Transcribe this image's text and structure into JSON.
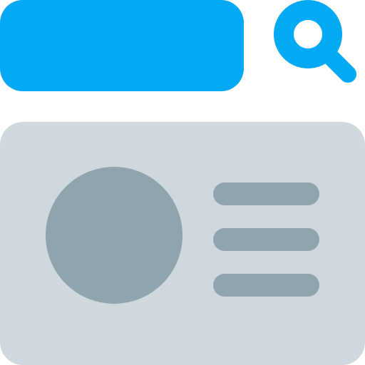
{
  "colors": {
    "accent": "#03A9F4",
    "card_background": "#CFD8DC",
    "placeholder": "#90A4AE",
    "page_background": "#FFFFFF"
  },
  "icons": {
    "search": "magnifier-icon"
  },
  "card": {
    "line_count": 3
  }
}
